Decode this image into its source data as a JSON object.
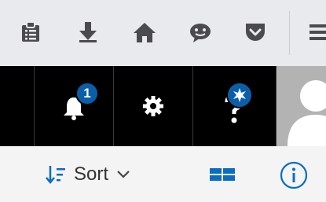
{
  "browser_toolbar": {
    "icons": [
      "clipboard-list-icon",
      "download-icon",
      "home-icon",
      "chat-icon",
      "pocket-icon",
      "menu-icon"
    ]
  },
  "suite_header": {
    "notifications_badge": "1",
    "icons": [
      "bell-icon",
      "gear-icon",
      "question-icon",
      "avatar"
    ]
  },
  "command_bar": {
    "sort_label": "Sort",
    "icons": [
      "sort-icon",
      "chevron-down-icon",
      "view-layout-icon",
      "info-icon"
    ]
  },
  "colors": {
    "browser_bg": "#e8eaee",
    "icon_gray": "#4a4a4f",
    "suite_bg": "#000000",
    "badge_blue": "#0b5ea8",
    "accent_blue": "#0a6cc2",
    "command_bg": "#f4f4f4"
  }
}
